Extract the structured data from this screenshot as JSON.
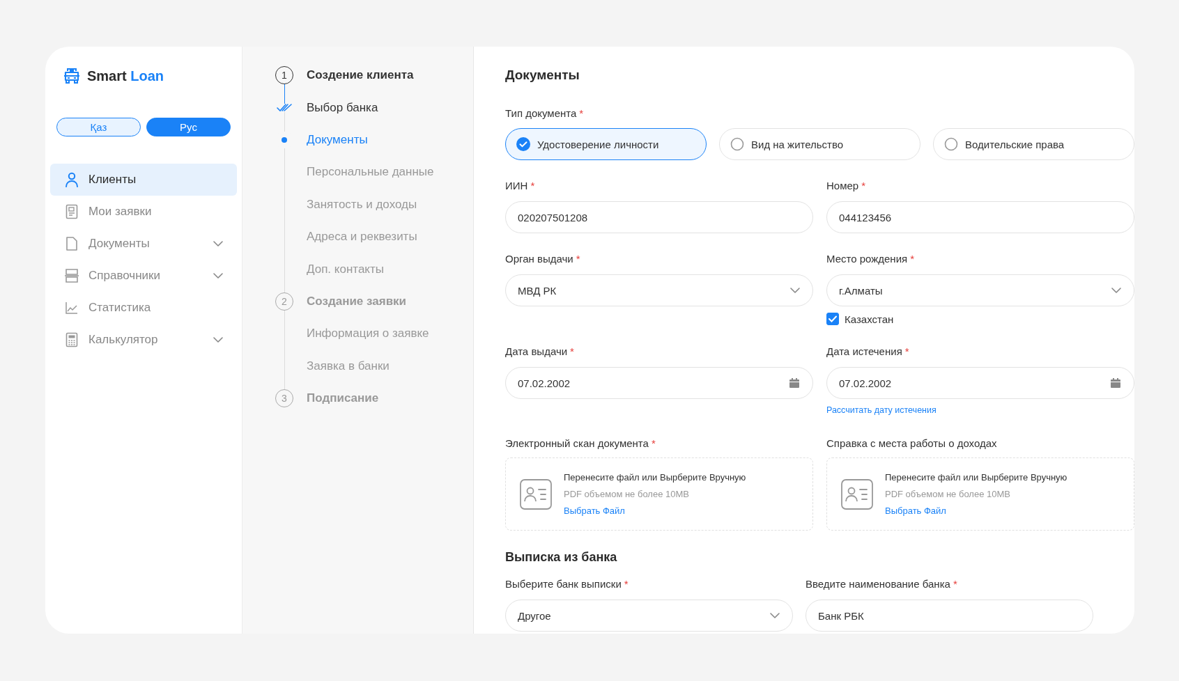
{
  "logo": {
    "name": "Smart",
    "accent": "Loan"
  },
  "languages": [
    {
      "label": "Қаз",
      "selected": false
    },
    {
      "label": "Рус",
      "selected": true
    }
  ],
  "nav": [
    {
      "label": "Клиенты",
      "selected": true,
      "expandable": false
    },
    {
      "label": "Мои заявки",
      "selected": false,
      "expandable": false
    },
    {
      "label": "Документы",
      "selected": false,
      "expandable": true
    },
    {
      "label": "Справочники",
      "selected": false,
      "expandable": true
    },
    {
      "label": "Статистика",
      "selected": false,
      "expandable": false
    },
    {
      "label": "Калькулятор",
      "selected": false,
      "expandable": true
    }
  ],
  "steps": [
    {
      "kind": "stage",
      "number": "1",
      "label": "Создение клиента",
      "active": true,
      "completed": false
    },
    {
      "kind": "substep",
      "label": "Выбор банка",
      "active": false,
      "completed": true
    },
    {
      "kind": "substep",
      "label": "Документы",
      "active": true,
      "completed": false
    },
    {
      "kind": "substep",
      "label": "Персональные данные",
      "active": false,
      "completed": false
    },
    {
      "kind": "substep",
      "label": "Занятость и доходы",
      "active": false,
      "completed": false
    },
    {
      "kind": "substep",
      "label": "Адреса и реквезиты",
      "active": false,
      "completed": false
    },
    {
      "kind": "substep",
      "label": "Доп. контакты",
      "active": false,
      "completed": false
    },
    {
      "kind": "stage",
      "number": "2",
      "label": "Создание заявки",
      "active": false,
      "completed": false
    },
    {
      "kind": "substep",
      "label": "Информация о заявке",
      "active": false,
      "completed": false
    },
    {
      "kind": "substep",
      "label": "Заявка в банки",
      "active": false,
      "completed": false
    },
    {
      "kind": "stage",
      "number": "3",
      "label": "Подписание",
      "active": false,
      "completed": false
    }
  ],
  "form": {
    "title": "Документы",
    "required_mark": "*",
    "doc_type": {
      "label": "Тип документа",
      "required": true,
      "options": [
        {
          "label": "Удостоверение личности",
          "selected": true
        },
        {
          "label": "Вид на жительство",
          "selected": false
        },
        {
          "label": "Водительские права",
          "selected": false
        }
      ]
    },
    "fields": [
      {
        "label": "ИИН",
        "required": true,
        "kind": "text",
        "value": "020207501208"
      },
      {
        "label": "Номер",
        "required": true,
        "kind": "text",
        "value": "044123456"
      },
      {
        "label": "Орган выдачи",
        "required": true,
        "kind": "select",
        "value": "МВД РК"
      },
      {
        "label": "Место рождения",
        "required": true,
        "kind": "select",
        "value": "г.Алматы",
        "checkbox": {
          "label": "Казахстан",
          "checked": true
        }
      },
      {
        "label": "Дата выдачи",
        "required": true,
        "kind": "date",
        "value": "07.02.2002"
      },
      {
        "label": "Дата истечения",
        "required": true,
        "kind": "date",
        "value": "07.02.2002",
        "link": "Рассчитать дату истечения"
      }
    ],
    "uploads": [
      {
        "label": "Электронный скан документа",
        "required": true,
        "prompt": "Перенесите файл или Вырберите Вручную",
        "hint": "PDF объемом не более 10MB",
        "link": "Выбрать Файл"
      },
      {
        "label": "Справка с места работы о доходах",
        "required": false,
        "prompt": "Перенесите файл или Вырберите Вручную",
        "hint": "PDF объемом не более 10MB",
        "link": "Выбрать Файл"
      }
    ],
    "bank_section": {
      "title": "Выписка из банка",
      "fields": [
        {
          "label": "Выберите банк выписки",
          "required": true,
          "kind": "select",
          "value": "Другое"
        },
        {
          "label": "Введите наименование банка",
          "required": true,
          "kind": "text",
          "value": "Банк РБК"
        }
      ]
    }
  }
}
